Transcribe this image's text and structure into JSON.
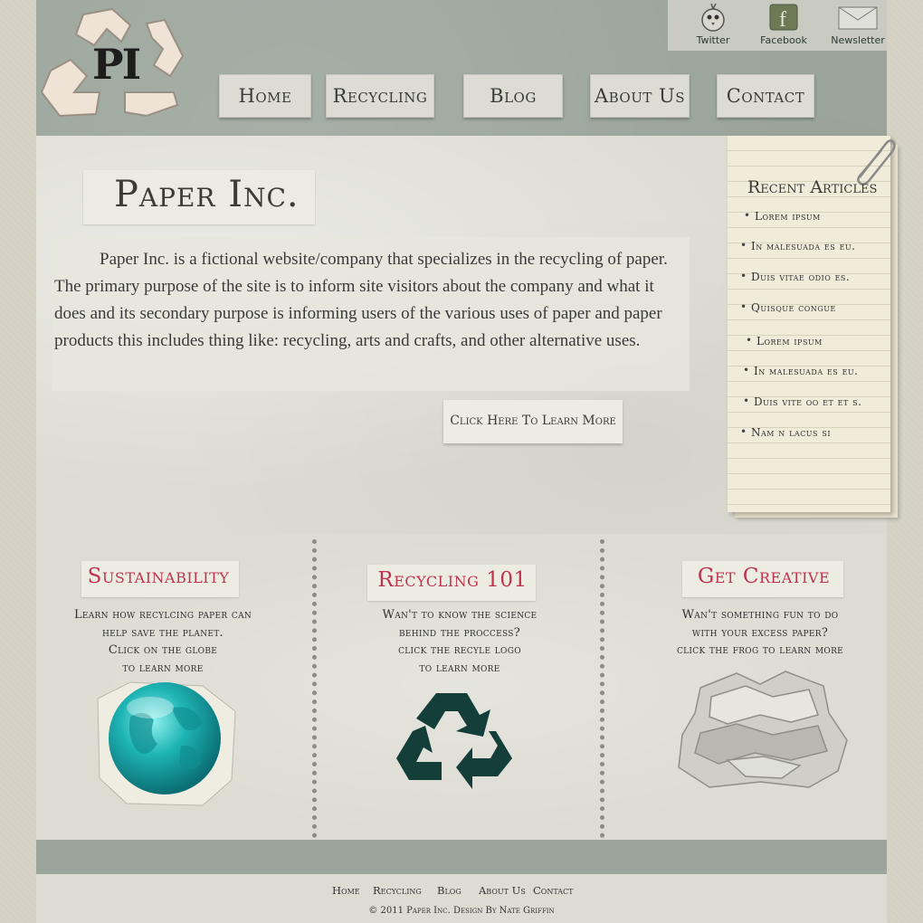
{
  "header": {
    "logo_text": "PI",
    "social": [
      {
        "label": "Twitter",
        "icon": "twitter-bird-icon"
      },
      {
        "label": "Facebook",
        "icon": "facebook-icon"
      },
      {
        "label": "Newsletter",
        "icon": "envelope-icon"
      }
    ],
    "nav": [
      "Home",
      "Recycling",
      "Blog",
      "About Us",
      "Contact"
    ]
  },
  "main": {
    "title": "Paper Inc.",
    "intro": "Paper Inc. is a fictional website/company that specializes in the recycling of paper. The primary   purpose of the site is to inform site visitors about the company and what it does and its secondary purpose is informing users of the various uses of paper and paper products this includes thing like: recycling, arts and crafts, and other alternative uses.",
    "learn_more": "Click Here To Learn More"
  },
  "articles": {
    "title": "Recent Articles",
    "items": [
      "Lorem ipsum",
      "In malesuada es eu.",
      "Duis vitae odio es.",
      "Quisque congue",
      "Lorem ipsum",
      "In malesuada es eu.",
      "Duis vite oo et et s.",
      "Nam n lacus si"
    ]
  },
  "columns": [
    {
      "title": "Sustainability",
      "text": [
        "Learn how recylcing paper can",
        "help save the planet.",
        "Click on the globe",
        "to learn more"
      ],
      "image": "globe-icon"
    },
    {
      "title": "Recycling  101",
      "text": [
        "Wan't to know the  science",
        "behind the proccess?",
        "click the recyle logo",
        "to learn more"
      ],
      "image": "recycle-icon"
    },
    {
      "title": "Get Creative",
      "text": [
        "Wan't something fun to do",
        "with your excess paper?",
        "click the frog to learn more"
      ],
      "image": "paper-frog-icon"
    }
  ],
  "footer": {
    "links": [
      "Home",
      "Recycling",
      "Blog",
      "About Us",
      "Contact"
    ],
    "copyright": "© 2011 Paper Inc. Design By Nate Griffin"
  },
  "colors": {
    "band": "#9aa59b",
    "paper": "#dcdcd3",
    "accent_title": "#c0334f",
    "recycle_logo": "#143e3a",
    "globe": "#1fb5b5"
  }
}
